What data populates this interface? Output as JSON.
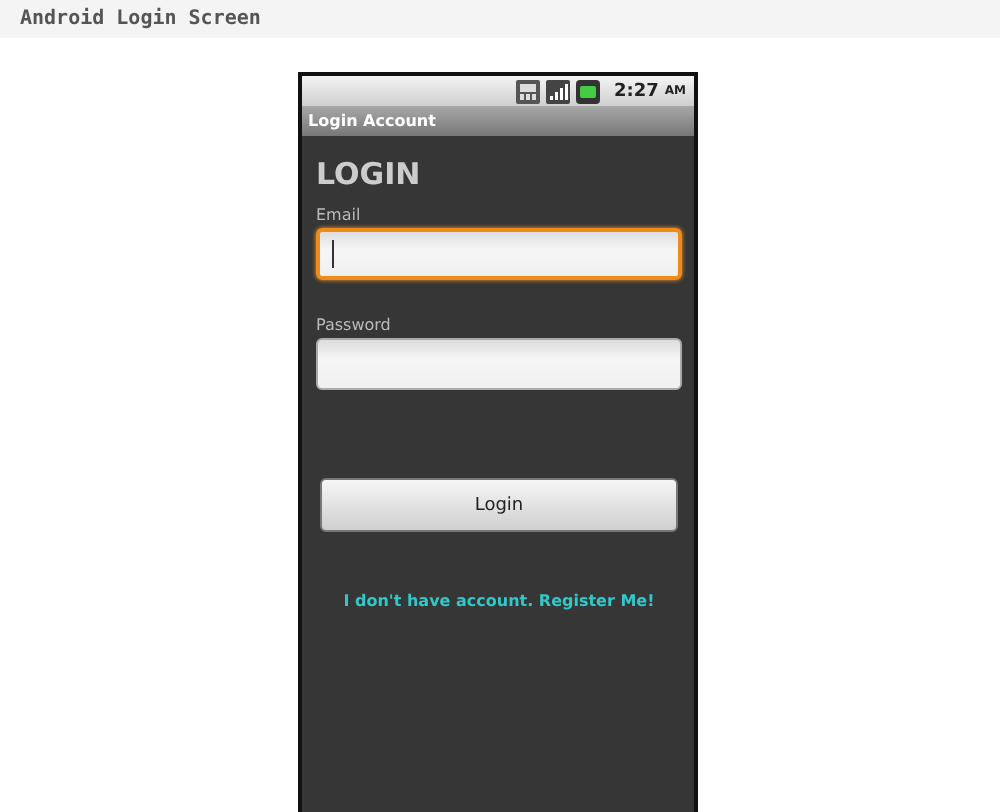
{
  "header": {
    "title": "Android Login Screen"
  },
  "phone": {
    "status_bar": {
      "time": "2:27",
      "meridiem": "AM"
    },
    "title_bar": {
      "title": "Login Account"
    },
    "heading": "LOGIN",
    "fields": [
      {
        "label": "Email",
        "focused": true
      },
      {
        "label": "Password",
        "focused": false
      }
    ],
    "button": {
      "label": "Login"
    },
    "link": "I don't have account. Register Me!"
  }
}
